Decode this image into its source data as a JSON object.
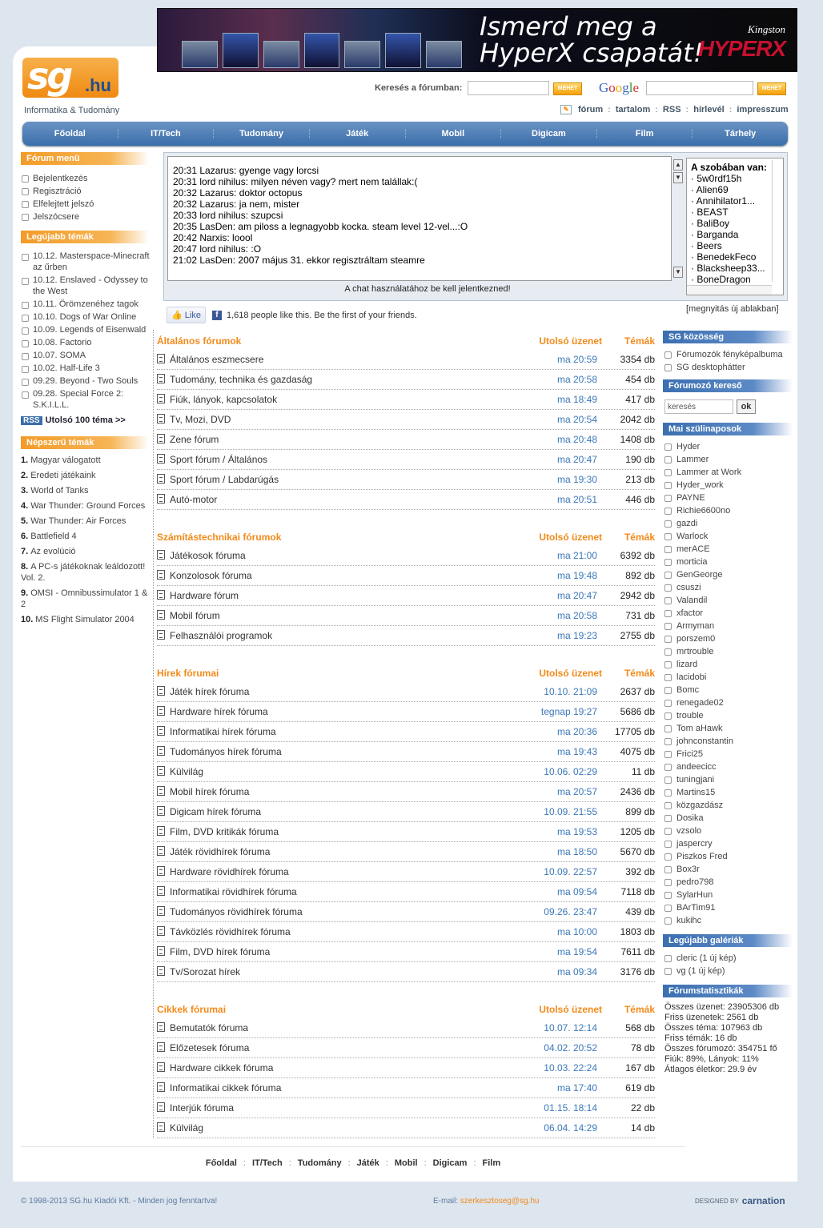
{
  "banner": {
    "text1": "Ismerd meg a",
    "text2": "HyperX csapatát!",
    "brand_top": "Kingston",
    "brand_main": "HYPERX"
  },
  "logo": {
    "sg": "sg",
    "tld": ".hu",
    "tagline": "Informatika & Tudomány"
  },
  "search": {
    "forum_label": "Keresés a fórumban:",
    "forum_value": "",
    "go": "MEHET",
    "google_value": "",
    "google_go": "MEHET"
  },
  "toplinks": [
    "fórum",
    "tartalom",
    "RSS",
    "hírlevél",
    "impresszum"
  ],
  "nav": [
    "Főoldal",
    "IT/Tech",
    "Tudomány",
    "Játék",
    "Mobil",
    "Digicam",
    "Film",
    "Tárhely"
  ],
  "left": {
    "menu_title": "Fórum menü",
    "menu": [
      "Bejelentkezés",
      "Regisztráció",
      "Elfelejtett jelszó",
      "Jelszócsere"
    ],
    "latest_title": "Legújabb témák",
    "latest": [
      "10.12. Masterspace-Minecraft az űrben",
      "10.12. Enslaved - Odyssey to the West",
      "10.11. Örömzenéhez tagok",
      "10.10. Dogs of War Online",
      "10.09. Legends of Eisenwald",
      "10.08. Factorio",
      "10.07. SOMA",
      "10.02. Half-Life 3",
      "09.29. Beyond - Two Souls",
      "09.28. Special Force 2: S.K.I.L.L."
    ],
    "rss_badge": "RSS",
    "rss_link": "Utolsó 100 téma >>",
    "popular_title": "Népszerű témák",
    "popular": [
      {
        "n": "1.",
        "t": "Magyar válogatott"
      },
      {
        "n": "2.",
        "t": "Eredeti játékaink"
      },
      {
        "n": "3.",
        "t": "World of Tanks"
      },
      {
        "n": "4.",
        "t": "War Thunder: Ground Forces"
      },
      {
        "n": "5.",
        "t": "War Thunder: Air Forces"
      },
      {
        "n": "6.",
        "t": "Battlefield 4"
      },
      {
        "n": "7.",
        "t": "Az evolúció"
      },
      {
        "n": "8.",
        "t": "A PC-s játékoknak leáldozott! Vol. 2."
      },
      {
        "n": "9.",
        "t": "OMSI - Omnibussimulator 1 & 2"
      },
      {
        "n": "10.",
        "t": "MS Flight Simulator 2004"
      }
    ]
  },
  "chat": {
    "lines": [
      "20:31 Lazarus: gyenge vagy lorcsi",
      "20:31 lord nihilus: milyen néven vagy? mert nem talállak:(",
      "20:32 Lazarus: doktor octopus",
      "20:32 Lazarus: ja nem, mister",
      "20:33 lord nihilus: szupcsi",
      "20:35 LasDen: am piloss a legnagyobb kocka. steam level 12-vel...:O",
      "20:42 Narxis: loool",
      "20:47 lord nihilus: :O",
      "21:02 LasDen: 2007 május 31. ekkor regisztráltam steamre"
    ],
    "login_notice": "A chat használatához be kell jelentkezned!",
    "room_title": "A szobában van:",
    "room_users": [
      "5w0rdf15h",
      "Alien69",
      "Annihilator1...",
      "BEAST",
      "BaliBoy",
      "Barganda",
      "Beers",
      "BenedekFeco",
      "Blacksheep33...",
      "BoneDragon"
    ],
    "new_window": "[megnyitás új ablakban]"
  },
  "fb": {
    "like": "Like",
    "text": "1,618 people like this. Be the first of your friends."
  },
  "forum_headers": {
    "last": "Utolsó üzenet",
    "topics": "Témák"
  },
  "groups": [
    {
      "title": "Általános fórumok",
      "rows": [
        {
          "name": "Általános eszmecsere",
          "last": "ma 20:59",
          "count": "3354 db"
        },
        {
          "name": "Tudomány, technika és gazdaság",
          "last": "ma 20:58",
          "count": "454 db"
        },
        {
          "name": "Fiúk, lányok, kapcsolatok",
          "last": "ma 18:49",
          "count": "417 db"
        },
        {
          "name": "Tv, Mozi, DVD",
          "last": "ma 20:54",
          "count": "2042 db"
        },
        {
          "name": "Zene fórum",
          "last": "ma 20:48",
          "count": "1408 db"
        },
        {
          "name": "Sport fórum / Általános",
          "last": "ma 20:47",
          "count": "190 db"
        },
        {
          "name": "Sport fórum / Labdarúgás",
          "last": "ma 19:30",
          "count": "213 db"
        },
        {
          "name": "Autó-motor",
          "last": "ma 20:51",
          "count": "446 db"
        }
      ]
    },
    {
      "title": "Számítástechnikai fórumok",
      "rows": [
        {
          "name": "Játékosok fóruma",
          "last": "ma 21:00",
          "count": "6392 db"
        },
        {
          "name": "Konzolosok fóruma",
          "last": "ma 19:48",
          "count": "892 db"
        },
        {
          "name": "Hardware fórum",
          "last": "ma 20:47",
          "count": "2942 db"
        },
        {
          "name": "Mobil fórum",
          "last": "ma 20:58",
          "count": "731 db"
        },
        {
          "name": "Felhasználói programok",
          "last": "ma 19:23",
          "count": "2755 db"
        }
      ]
    },
    {
      "title": "Hírek fórumai",
      "rows": [
        {
          "name": "Játék hírek fóruma",
          "last": "10.10. 21:09",
          "count": "2637 db"
        },
        {
          "name": "Hardware hírek fóruma",
          "last": "tegnap 19:27",
          "count": "5686 db"
        },
        {
          "name": "Informatikai hírek fóruma",
          "last": "ma 20:36",
          "count": "17705 db"
        },
        {
          "name": "Tudományos hírek fóruma",
          "last": "ma 19:43",
          "count": "4075 db"
        },
        {
          "name": "Külvilág",
          "last": "10.06. 02:29",
          "count": "11 db"
        },
        {
          "name": "Mobil hírek fóruma",
          "last": "ma 20:57",
          "count": "2436 db"
        },
        {
          "name": "Digicam hírek fóruma",
          "last": "10.09. 21:55",
          "count": "899 db"
        },
        {
          "name": "Film, DVD kritikák fóruma",
          "last": "ma 19:53",
          "count": "1205 db"
        },
        {
          "name": "Játék rövidhírek fóruma",
          "last": "ma 18:50",
          "count": "5670 db"
        },
        {
          "name": "Hardware rövidhírek fóruma",
          "last": "10.09. 22:57",
          "count": "392 db"
        },
        {
          "name": "Informatikai rövidhírek fóruma",
          "last": "ma 09:54",
          "count": "7118 db"
        },
        {
          "name": "Tudományos rövidhírek fóruma",
          "last": "09.26. 23:47",
          "count": "439 db"
        },
        {
          "name": "Távközlés rövidhírek fóruma",
          "last": "ma 10:00",
          "count": "1803 db"
        },
        {
          "name": "Film, DVD hírek fóruma",
          "last": "ma 19:54",
          "count": "7611 db"
        },
        {
          "name": "Tv/Sorozat hírek",
          "last": "ma 09:34",
          "count": "3176 db"
        }
      ]
    },
    {
      "title": "Cikkek fórumai",
      "rows": [
        {
          "name": "Bemutatók fóruma",
          "last": "10.07. 12:14",
          "count": "568 db"
        },
        {
          "name": "Előzetesek fóruma",
          "last": "04.02. 20:52",
          "count": "78 db"
        },
        {
          "name": "Hardware cikkek fóruma",
          "last": "10.03. 22:24",
          "count": "167 db"
        },
        {
          "name": "Informatikai cikkek fóruma",
          "last": "ma 17:40",
          "count": "619 db"
        },
        {
          "name": "Interjúk fóruma",
          "last": "01.15. 18:14",
          "count": "22 db"
        },
        {
          "name": "Külvilág",
          "last": "06.04. 14:29",
          "count": "14 db"
        }
      ]
    }
  ],
  "right": {
    "community_title": "SG közösség",
    "community": [
      "Fórumozók fényképalbuma",
      "SG desktophátter"
    ],
    "user_search_title": "Fórumozó kereső",
    "user_search_value": "keresés",
    "user_search_btn": "ok",
    "bday_title": "Mai szülinaposok",
    "bday": [
      "Hyder",
      "Lammer",
      "Lammer at Work",
      "Hyder_work",
      "PAYNE",
      "Richie6600no",
      "gazdi",
      "Warlock",
      "merACE",
      "morticia",
      "GenGeorge",
      "csuszi",
      "Valandil",
      "xfactor",
      "Armyman",
      "porszem0",
      "mrtrouble",
      "lizard",
      "lacidobi",
      "Bomc",
      "renegade02",
      "trouble",
      "Tom aHawk",
      "johnconstantin",
      "Frici25",
      "andeecicc",
      "tuningjani",
      "Martins15",
      "közgazdász",
      "Dosika",
      "vzsolo",
      "jaspercry",
      "Piszkos Fred",
      "Box3r",
      "pedro798",
      "SylarHun",
      "BArTim91",
      "kukihc"
    ],
    "gallery_title": "Legújabb galériák",
    "gallery": [
      "cleric (1 új kép)",
      "vg (1 új kép)"
    ],
    "stats_title": "Fórumstatisztikák",
    "stats": [
      "Összes üzenet: 23905306 db",
      "Friss üzenetek: 2561 db",
      "Összes téma: 107963 db",
      "Friss témák: 16 db",
      "Összes fórumozó: 354751 fő",
      "Fiúk: 89%, Lányok: 11%",
      "Átlagos életkor: 29.9 év"
    ]
  },
  "footer": {
    "nav": [
      "Főoldal",
      "IT/Tech",
      "Tudomány",
      "Játék",
      "Mobil",
      "Digicam",
      "Film"
    ],
    "copyright": "© 1998-2013 SG.hu Kiadói Kft. - Minden jog fenntartva!",
    "email_label": "E-mail: ",
    "email": "szerkesztoseg@sg.hu",
    "designed_by": "DESIGNED BY",
    "designer": "carnation"
  }
}
